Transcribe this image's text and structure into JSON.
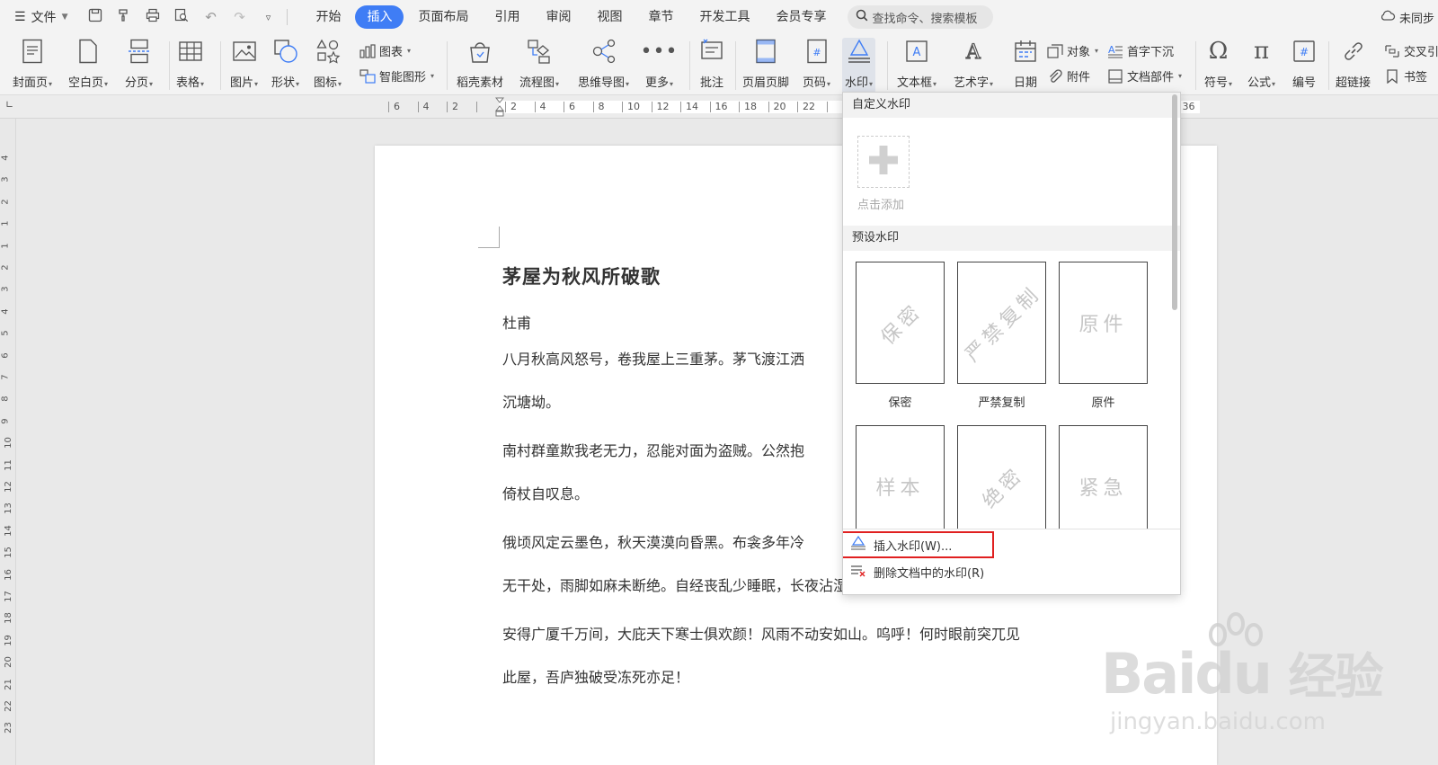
{
  "menubar": {
    "file_label": "文件",
    "tabs": [
      "开始",
      "插入",
      "页面布局",
      "引用",
      "审阅",
      "视图",
      "章节",
      "开发工具",
      "会员专享"
    ],
    "active_tab": "插入",
    "search_placeholder": "查找命令、搜索模板",
    "sync_label": "未同步"
  },
  "ribbon": {
    "cover": "封面页",
    "blank": "空白页",
    "pagebreak": "分页",
    "table": "表格",
    "picture": "图片",
    "shape": "形状",
    "icon": "图标",
    "chart": "图表",
    "smartart": "智能图形",
    "material": "稻壳素材",
    "flowchart": "流程图",
    "mindmap": "思维导图",
    "more": "更多",
    "comment": "批注",
    "header_footer": "页眉页脚",
    "page_number": "页码",
    "watermark": "水印",
    "textbox": "文本框",
    "wordart": "艺术字",
    "date": "日期",
    "object": "对象",
    "attachment": "附件",
    "dropcap": "首字下沉",
    "doc_parts": "文档部件",
    "symbol": "符号",
    "formula": "公式",
    "numbering": "编号",
    "hyperlink": "超链接",
    "crossref": "交叉引",
    "bookmark": "书签"
  },
  "ruler": {
    "ticks": [
      "6",
      "4",
      "2",
      "",
      "2",
      "4",
      "6",
      "8",
      "10",
      "12",
      "14",
      "16",
      "18",
      "20",
      "22",
      "",
      "",
      "",
      "",
      "",
      "",
      "",
      "",
      "",
      "",
      "",
      "",
      "36"
    ],
    "vticks": [
      "4",
      "3",
      "2",
      "1",
      "1",
      "2",
      "3",
      "4",
      "5",
      "6",
      "7",
      "8",
      "9",
      "10",
      "11",
      "12",
      "13",
      "14",
      "15",
      "16",
      "17",
      "18",
      "19",
      "20",
      "21",
      "22",
      "23"
    ]
  },
  "document": {
    "title": "茅屋为秋风所破歌",
    "author": "杜甫",
    "lines": [
      "八月秋高风怒号，卷我屋上三重茅。茅飞渡江洒",
      "沉塘坳。",
      "南村群童欺我老无力，忍能对面为盗贼。公然抱",
      "倚杖自叹息。",
      "俄顷风定云墨色，秋天漠漠向昏黑。布衾多年冷",
      "无干处，雨脚如麻未断绝。自经丧乱少睡眠，长夜沾湿何由彻！",
      "安得广厦千万间，大庇天下寒士俱欢颜！风雨不动安如山。呜呼！何时眼前突兀见",
      "此屋，吾庐独破受冻死亦足！"
    ]
  },
  "watermark_panel": {
    "custom_header": "自定义水印",
    "add_label": "点击添加",
    "preset_header": "预设水印",
    "presets": [
      {
        "text": "保密",
        "caption": "保密",
        "rotate": -45
      },
      {
        "text": "严禁复制",
        "caption": "严禁复制",
        "rotate": -45
      },
      {
        "text": "原件",
        "caption": "原件",
        "rotate": 0
      },
      {
        "text": "样本",
        "caption": "",
        "rotate": 0
      },
      {
        "text": "绝密",
        "caption": "",
        "rotate": -45
      },
      {
        "text": "紧急",
        "caption": "",
        "rotate": 0
      }
    ],
    "insert_label": "插入水印(W)...",
    "delete_label": "删除文档中的水印(R)"
  },
  "baidu_watermark": {
    "brand": "Bai",
    "brand2": "du",
    "cn": "经验",
    "url": "jingyan.baidu.com"
  }
}
